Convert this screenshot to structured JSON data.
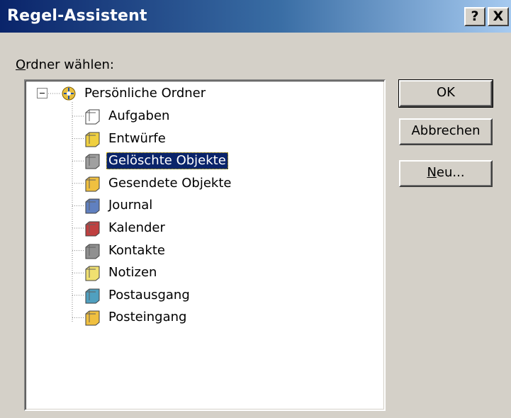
{
  "window": {
    "title": "Regel-Assistent",
    "help_button": "?",
    "close_button": "X"
  },
  "label": {
    "mnemonic": "O",
    "rest": "rdner wählen:"
  },
  "tree": {
    "root": {
      "label": "Persönliche Ordner",
      "icon": "personal-folders-icon",
      "expanded": true
    },
    "items": [
      {
        "label": "Aufgaben",
        "icon": "tasks-icon",
        "selected": false
      },
      {
        "label": "Entwürfe",
        "icon": "drafts-icon",
        "selected": false
      },
      {
        "label": "Gelöschte Objekte",
        "icon": "deleted-items-icon",
        "selected": true
      },
      {
        "label": "Gesendete Objekte",
        "icon": "sent-items-icon",
        "selected": false
      },
      {
        "label": "Journal",
        "icon": "journal-icon",
        "selected": false
      },
      {
        "label": "Kalender",
        "icon": "calendar-icon",
        "selected": false
      },
      {
        "label": "Kontakte",
        "icon": "contacts-icon",
        "selected": false
      },
      {
        "label": "Notizen",
        "icon": "notes-icon",
        "selected": false
      },
      {
        "label": "Postausgang",
        "icon": "outbox-icon",
        "selected": false
      },
      {
        "label": "Posteingang",
        "icon": "inbox-icon",
        "selected": false
      }
    ]
  },
  "buttons": {
    "ok": "OK",
    "cancel": "Abbrechen",
    "new_mnemonic": "N",
    "new_rest": "eu..."
  },
  "colors": {
    "selection": "#0a246a",
    "titlebar_start": "#0a246a",
    "titlebar_end": "#a6caf0",
    "dialog_bg": "#d4d0c8"
  }
}
